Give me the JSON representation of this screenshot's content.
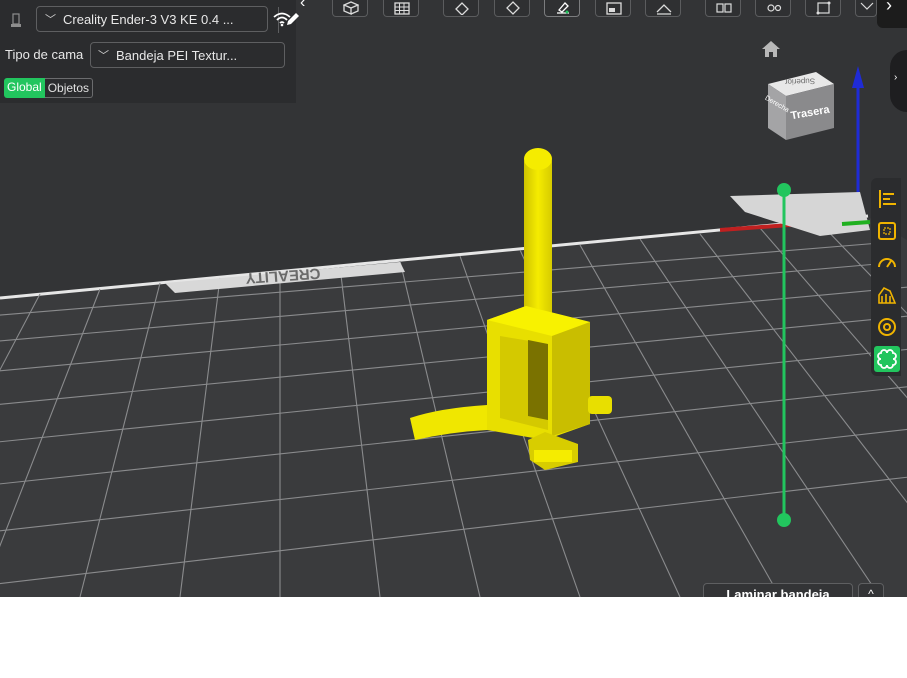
{
  "printer": {
    "name": "Creality Ender-3 V3 KE 0.4 ..."
  },
  "bed": {
    "label": "Tipo de cama",
    "value": "Bandeja PEI Textur..."
  },
  "tabs": [
    {
      "label": "Global",
      "active": true
    },
    {
      "label": "Objetos",
      "active": false
    }
  ],
  "viewport": {
    "view_cube_front": "Trasera",
    "view_cube_side": "Derecha",
    "view_cube_top": "Superior",
    "bed_logo": "CREALITY"
  },
  "right_toolbar": {
    "items": [
      {
        "icon": "align-icon"
      },
      {
        "icon": "layout-icon"
      },
      {
        "icon": "speed-icon"
      },
      {
        "icon": "support-icon"
      },
      {
        "icon": "target-icon"
      },
      {
        "icon": "arrange-icon",
        "active": true
      }
    ]
  },
  "slice": {
    "label": "Laminar bandeja",
    "more": "^"
  },
  "colors": {
    "accent": "#22c55e",
    "model": "#f5ec00",
    "viewport_bg": "#333436",
    "panel_bg": "#2b2c2e"
  }
}
